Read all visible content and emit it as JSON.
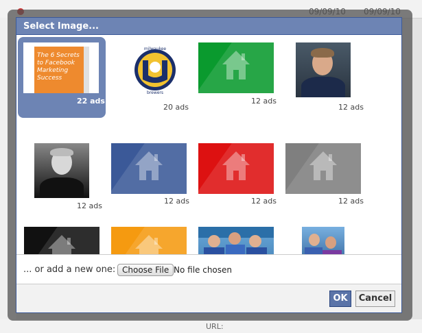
{
  "background": {
    "dates": [
      "09/09/10",
      "09/09/10"
    ],
    "url_label": "URL:"
  },
  "dialog": {
    "title": "Select Image...",
    "images": [
      {
        "kind": "book",
        "ads": "22 ads",
        "selected": true,
        "book_text": "The 6 Secrets to Facebook Marketing Success"
      },
      {
        "kind": "logo",
        "ads": "20 ads",
        "logo_top": "milwaukee",
        "logo_bottom": "brewers"
      },
      {
        "kind": "house",
        "color": "#0a9a2e",
        "ads": "12 ads"
      },
      {
        "kind": "photo",
        "ads": "12 ads"
      },
      {
        "kind": "photo-bw",
        "ads": "12 ads"
      },
      {
        "kind": "house",
        "color": "#3b5998",
        "ads": "12 ads"
      },
      {
        "kind": "house",
        "color": "#dd1111",
        "ads": "12 ads"
      },
      {
        "kind": "house",
        "color": "#7f7f7f",
        "ads": "12 ads"
      },
      {
        "kind": "house",
        "color": "#111111",
        "ads": ""
      },
      {
        "kind": "house",
        "color": "#f59a10",
        "ads": ""
      },
      {
        "kind": "photo-group",
        "ads": ""
      },
      {
        "kind": "photo-pair",
        "ads": ""
      }
    ],
    "upload": {
      "label": "... or add a new one:",
      "choose_button": "Choose File",
      "no_file": "No file chosen"
    },
    "buttons": {
      "ok": "OK",
      "cancel": "Cancel"
    }
  }
}
